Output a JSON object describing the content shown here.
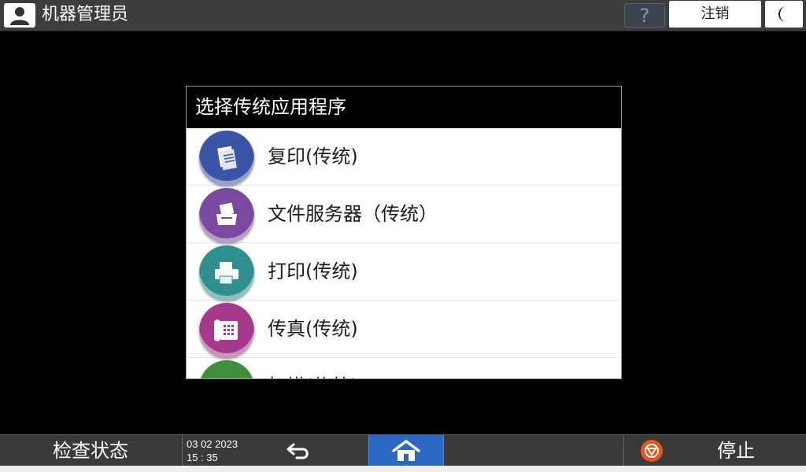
{
  "header": {
    "user_title": "机器管理员",
    "help_label": "?",
    "logout_label": "注销"
  },
  "dialog": {
    "title": "选择传统应用程序",
    "items": [
      {
        "label": "复印(传统)",
        "icon": "copier-icon",
        "color": "#3a55a8"
      },
      {
        "label": "文件服务器（传统）",
        "icon": "document-server-icon",
        "color": "#7a4aa0"
      },
      {
        "label": "打印(传统)",
        "icon": "printer-icon",
        "color": "#2f8f8e"
      },
      {
        "label": "传真(传统)",
        "icon": "fax-icon",
        "color": "#a53a8c"
      },
      {
        "label": "扫描(传统)",
        "icon": "scanner-icon",
        "color": "#3f8f3a"
      }
    ]
  },
  "footer": {
    "status_label": "检查状态",
    "date": "03 02 2023",
    "time": "15 : 35",
    "stop_label": "停止"
  },
  "colors": {
    "home_active": "#2d67c4",
    "stop_accent": "#e8561e",
    "bar_bg": "#3a3a3a"
  }
}
